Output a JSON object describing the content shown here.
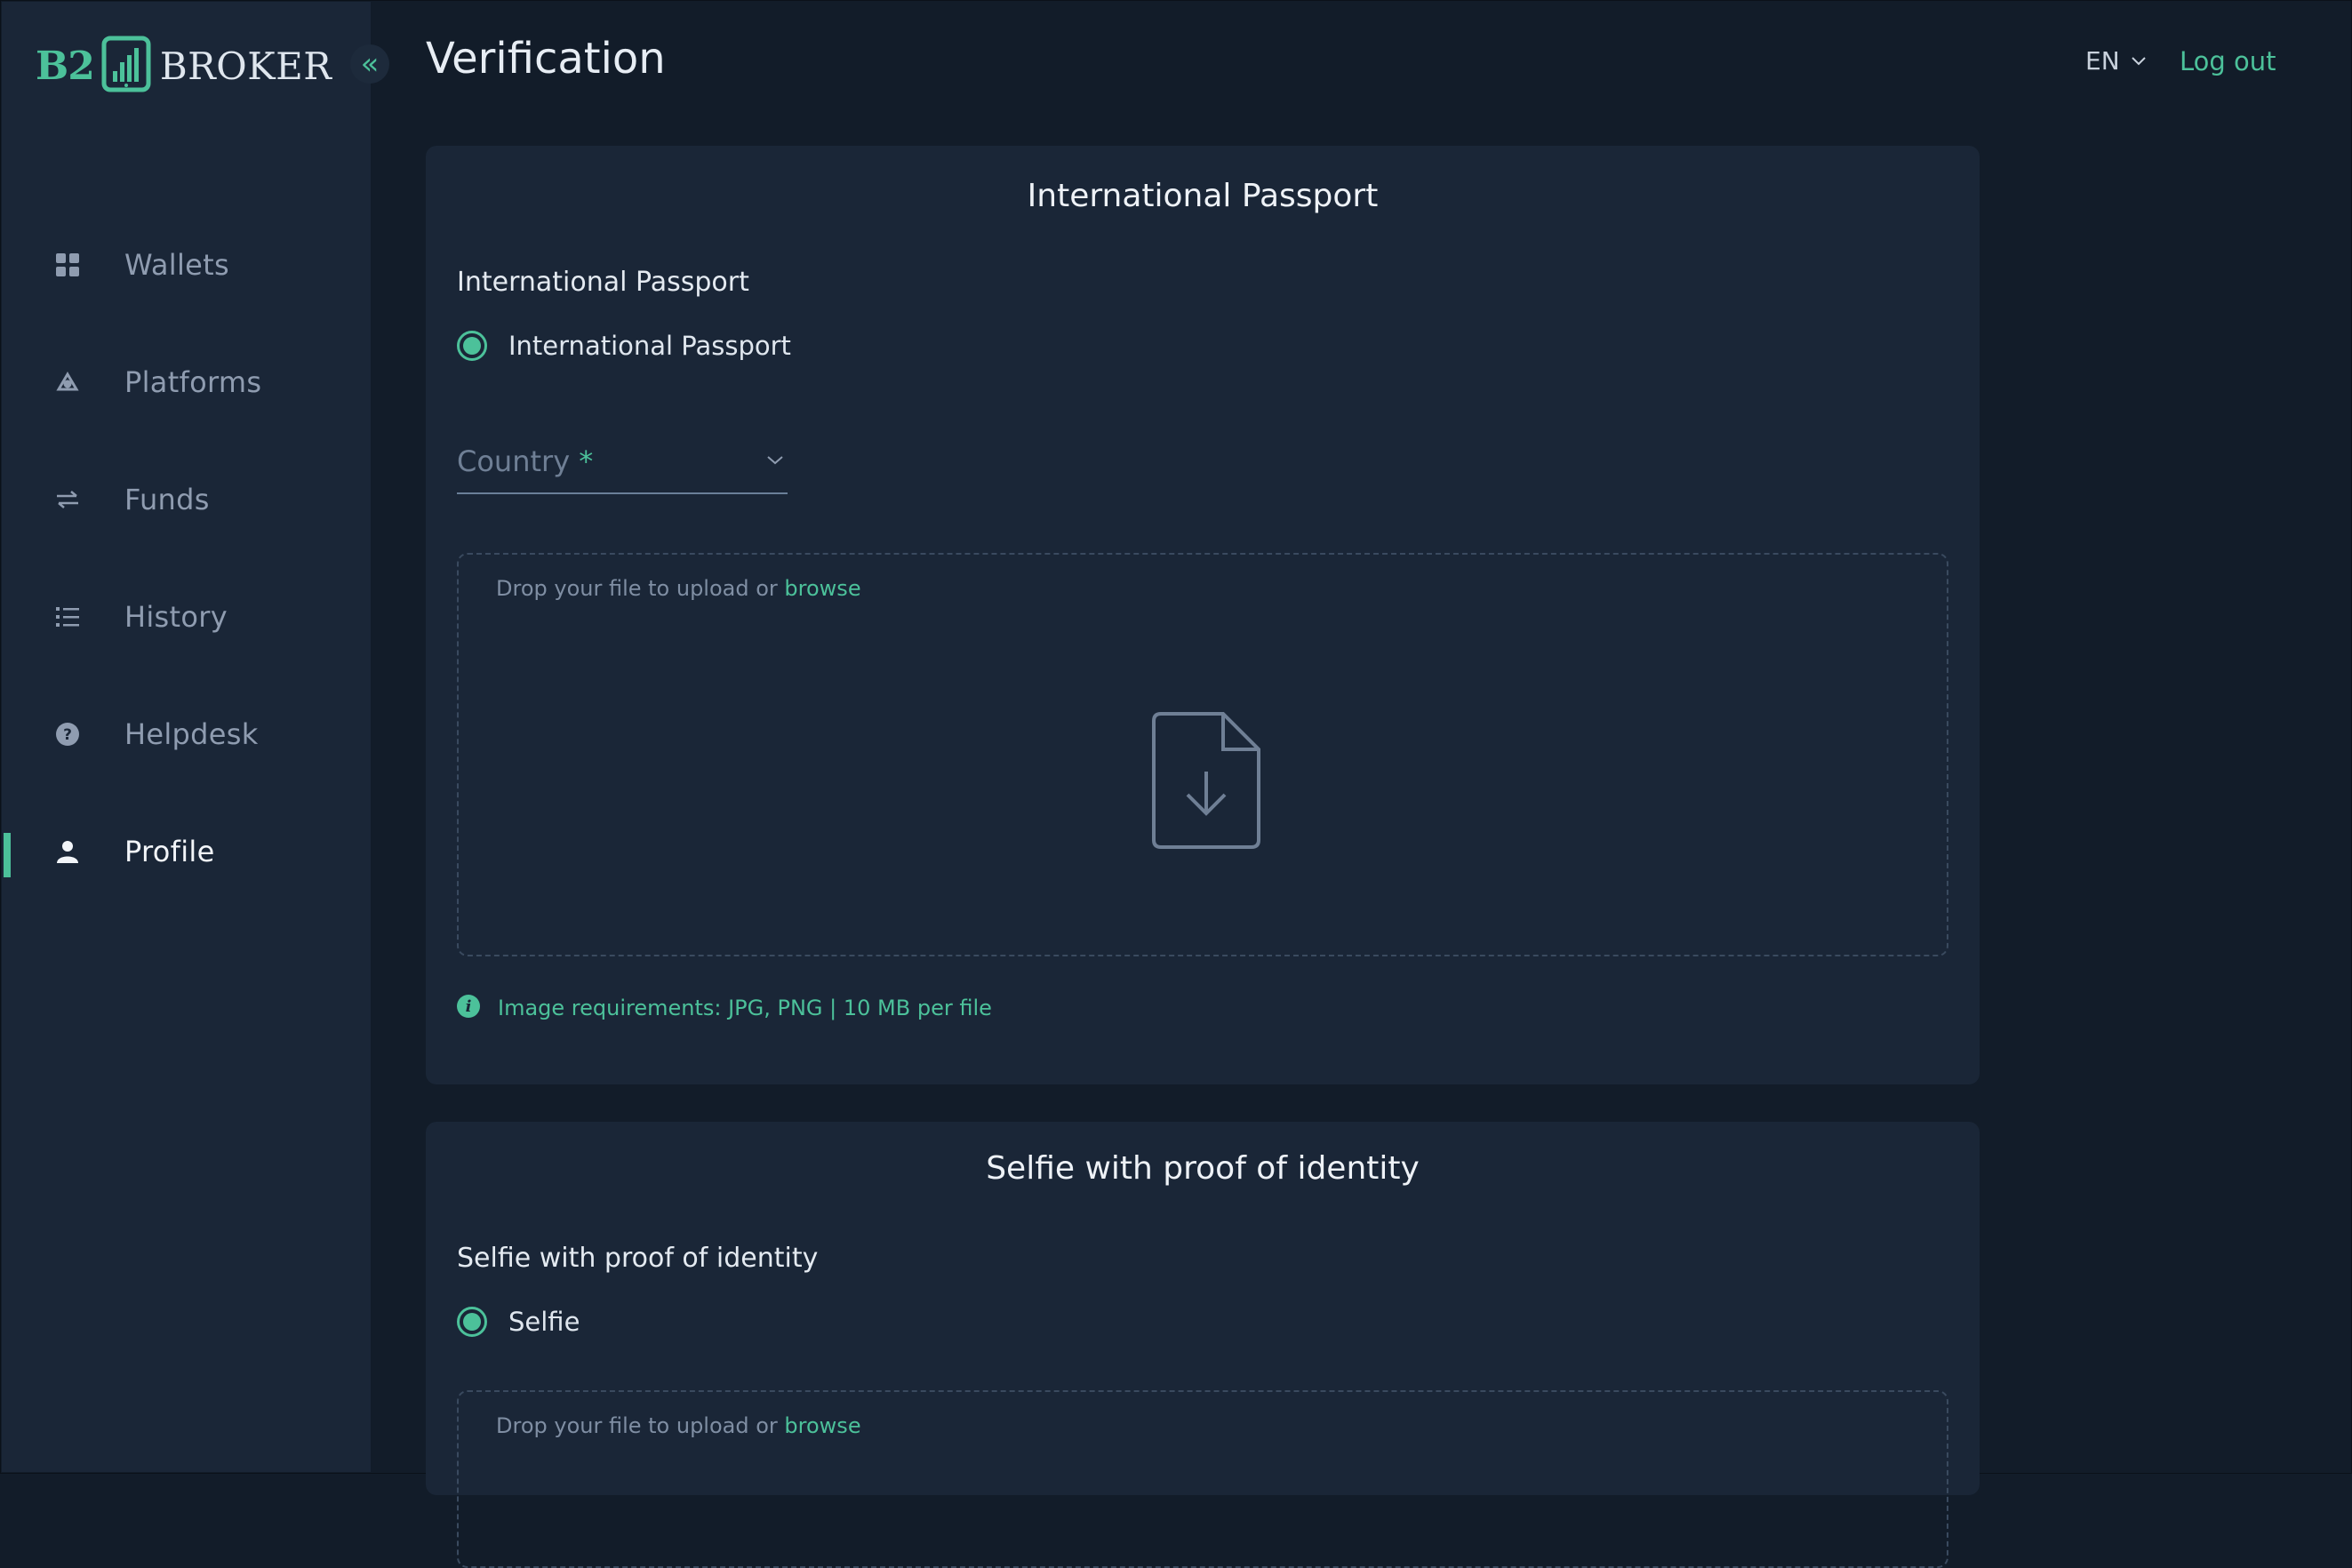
{
  "brand": {
    "prefix": "B2",
    "name": "BROKER",
    "accent": "#4cc19a"
  },
  "header": {
    "title": "Verification",
    "language": "EN",
    "logout": "Log out"
  },
  "sidebar": {
    "collapse_icon": "double-chevron-left-icon",
    "items": [
      {
        "label": "Wallets",
        "icon": "grid-icon",
        "active": false
      },
      {
        "label": "Platforms",
        "icon": "platforms-icon",
        "active": false
      },
      {
        "label": "Funds",
        "icon": "transfer-arrows-icon",
        "active": false
      },
      {
        "label": "History",
        "icon": "list-icon",
        "active": false
      },
      {
        "label": "Helpdesk",
        "icon": "help-circle-icon",
        "active": false
      },
      {
        "label": "Profile",
        "icon": "user-icon",
        "active": true
      }
    ]
  },
  "passport_card": {
    "title": "International Passport",
    "section_label": "International Passport",
    "option_label": "International Passport",
    "country_placeholder": "Country",
    "required_mark": "*",
    "dropzone_text": "Drop your file to upload or",
    "browse_link": "browse",
    "requirements": "Image requirements: JPG, PNG | 10 MB per file"
  },
  "selfie_card": {
    "title": "Selfie with proof of identity",
    "section_label": "Selfie with proof of identity",
    "option_label": "Selfie",
    "dropzone_text": "Drop your file to upload or",
    "browse_link": "browse"
  }
}
